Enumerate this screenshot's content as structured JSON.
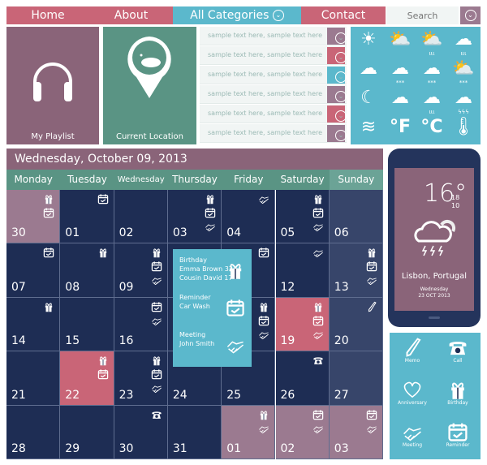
{
  "colors": {
    "red": "#c96577",
    "blue": "#5bb8cc",
    "mauve": "#8a6a80",
    "green": "#5a9484",
    "navy": "#1e2d54",
    "sunday": "#37456a"
  },
  "nav": {
    "home": "Home",
    "about": "About",
    "categories": "All Categories",
    "contact": "Contact",
    "search_placeholder": "Search"
  },
  "tiles": {
    "playlist": "My Playlist",
    "location": "Current Location"
  },
  "list": {
    "items": [
      "sample text here, sample text here",
      "sample text here, sample text here",
      "sample text here, sample text here",
      "sample text here, sample text here",
      "sample text here, sample text here",
      "sample text here, sample text here"
    ],
    "button_colors": [
      "#9b7a90",
      "#c96577",
      "#5bb8cc",
      "#9b7a90",
      "#c96577",
      "#9b7a90"
    ]
  },
  "weather_icons": [
    "sun",
    "partly-cloudy",
    "partly-cloudy-rain",
    "cloud-rain",
    "cloud",
    "cloud-snow",
    "cloud-snow",
    "partly-cloudy-snow",
    "moon",
    "cloud-moon",
    "cloud-moon-rain",
    "cloud-thunder",
    "wind",
    "fahrenheit",
    "celsius",
    "thermometers"
  ],
  "weather_labels": {
    "f": "°F",
    "c": "°C"
  },
  "calendar": {
    "title": "Wednesday, October 09, 2013",
    "days": [
      "Monday",
      "Tuesday",
      "Wednesday",
      "Thursday",
      "Friday",
      "Saturday",
      "Sunday"
    ],
    "cells": [
      {
        "n": "30",
        "bg": "mauve",
        "i": [
          "gift",
          "cal"
        ]
      },
      {
        "n": "01",
        "i": [
          "cal"
        ]
      },
      {
        "n": "02",
        "i": []
      },
      {
        "n": "03",
        "i": [
          "gift",
          "cal",
          "hand"
        ]
      },
      {
        "n": "04",
        "i": [
          "hand"
        ]
      },
      {
        "n": "05",
        "i": [
          "gift",
          "cal",
          "hand"
        ]
      },
      {
        "n": "06",
        "bg": "sunday",
        "i": []
      },
      {
        "n": "07",
        "i": [
          "cal"
        ]
      },
      {
        "n": "08",
        "i": [
          "gift"
        ]
      },
      {
        "n": "09",
        "i": [
          "gift",
          "cal",
          "hand"
        ]
      },
      {
        "n": "10",
        "i": []
      },
      {
        "n": "11",
        "i": [
          "cal"
        ]
      },
      {
        "n": "12",
        "i": [
          "hand"
        ]
      },
      {
        "n": "13",
        "bg": "sunday",
        "i": [
          "gift",
          "cal",
          "hand"
        ]
      },
      {
        "n": "14",
        "i": [
          "gift"
        ]
      },
      {
        "n": "15",
        "i": []
      },
      {
        "n": "16",
        "i": [
          "cal",
          "hand"
        ]
      },
      {
        "n": "17",
        "i": []
      },
      {
        "n": "18",
        "i": [
          "gift",
          "cal",
          "hand"
        ]
      },
      {
        "n": "19",
        "bg": "red",
        "i": [
          "gift",
          "cal",
          "hand"
        ]
      },
      {
        "n": "20",
        "bg": "sunday",
        "i": [
          "pencil"
        ]
      },
      {
        "n": "21",
        "i": []
      },
      {
        "n": "22",
        "bg": "red",
        "i": [
          "gift",
          "cal"
        ]
      },
      {
        "n": "23",
        "i": [
          "gift",
          "cal",
          "hand"
        ]
      },
      {
        "n": "24",
        "i": [
          "cal"
        ]
      },
      {
        "n": "25",
        "i": []
      },
      {
        "n": "26",
        "i": [
          "phone"
        ]
      },
      {
        "n": "27",
        "bg": "sunday",
        "i": []
      },
      {
        "n": "28",
        "i": []
      },
      {
        "n": "29",
        "i": []
      },
      {
        "n": "30",
        "i": [
          "phone"
        ]
      },
      {
        "n": "31",
        "i": []
      },
      {
        "n": "01",
        "bg": "mauve",
        "i": [
          "gift",
          "hand"
        ]
      },
      {
        "n": "02",
        "bg": "mauve",
        "i": [
          "cal",
          "hand"
        ]
      },
      {
        "n": "03",
        "bg": "mauve",
        "i": [
          "cal",
          "hand"
        ]
      }
    ]
  },
  "popup": {
    "birthday": "Birthday",
    "b1": "Emma Brown 32",
    "b2": "Cousin David 17",
    "reminder": "Reminder",
    "r1": "Car Wash",
    "meeting": "Meeting",
    "m1": "John Smith"
  },
  "phone": {
    "temp": "16°",
    "high": "18",
    "low": "10",
    "city": "Lisbon, Portugal",
    "day": "Wednesday",
    "date": "23 OCT 2013"
  },
  "pad": {
    "memo": "Memo",
    "call": "Call",
    "anniversary": "Anniversary",
    "birthday": "Birthday",
    "meeting": "Meeting",
    "reminder": "Reminder"
  }
}
